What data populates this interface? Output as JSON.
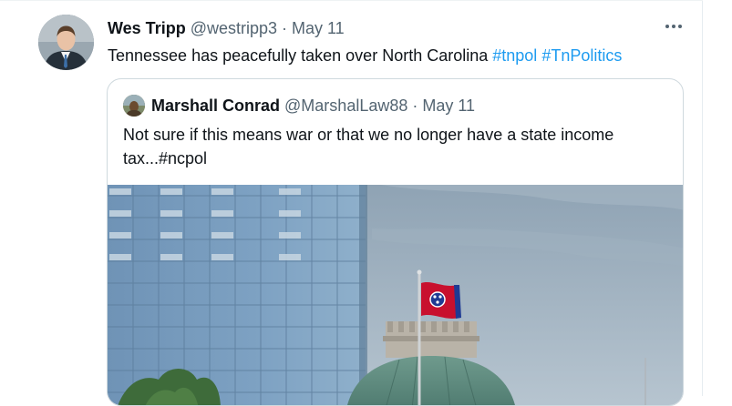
{
  "tweet": {
    "author_name": "Wes Tripp",
    "handle": "@westripp3",
    "separator": "·",
    "date": "May 11",
    "text": "Tennessee has peacefully taken over North Carolina",
    "hashtags": [
      "#tnpol",
      "#TnPolitics"
    ]
  },
  "quoted_tweet": {
    "author_name": "Marshall Conrad",
    "handle": "@MarshalLaw88",
    "separator": "·",
    "date": "May 11",
    "text": "Not sure if this means war or that we no longer have a state income tax...#ncpol"
  },
  "colors": {
    "link": "#1d9bf0",
    "muted": "#536471",
    "text": "#0f1419",
    "flag_red": "#c8102e",
    "flag_blue": "#1f3a93"
  },
  "icons": {
    "more": "more-horizontal-icon"
  }
}
